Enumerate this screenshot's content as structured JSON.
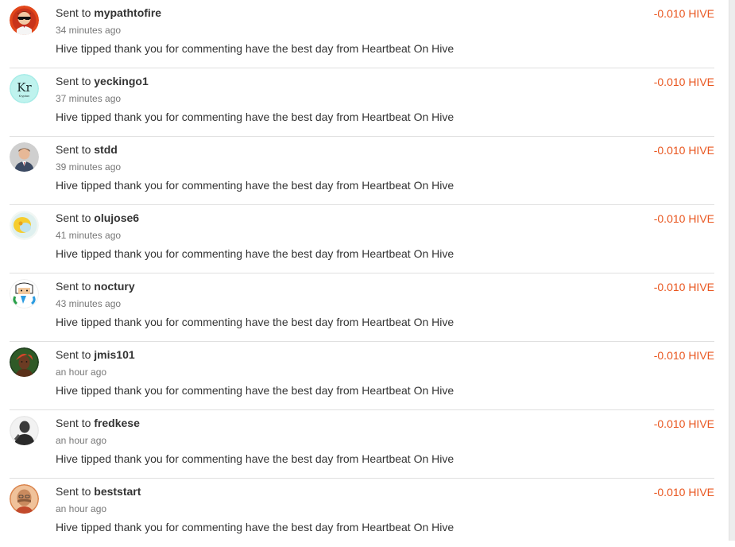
{
  "transfers": [
    {
      "prefix": "Sent to",
      "user": "mypathtofire",
      "time": "34 minutes ago",
      "memo": "Hive tipped thank you for commenting have the best day from Heartbeat On Hive",
      "amount": "-0.010 HIVE",
      "avatar": "avatar-sunglasses"
    },
    {
      "prefix": "Sent to",
      "user": "yeckingo1",
      "time": "37 minutes ago",
      "memo": "Hive tipped thank you for commenting have the best day from Heartbeat On Hive",
      "amount": "-0.010 HIVE",
      "avatar": "avatar-krypton"
    },
    {
      "prefix": "Sent to",
      "user": "stdd",
      "time": "39 minutes ago",
      "memo": "Hive tipped thank you for commenting have the best day from Heartbeat On Hive",
      "amount": "-0.010 HIVE",
      "avatar": "avatar-man-suit"
    },
    {
      "prefix": "Sent to",
      "user": "olujose6",
      "time": "41 minutes ago",
      "memo": "Hive tipped thank you for commenting have the best day from Heartbeat On Hive",
      "amount": "-0.010 HIVE",
      "avatar": "avatar-yellow-blob"
    },
    {
      "prefix": "Sent to",
      "user": "noctury",
      "time": "43 minutes ago",
      "memo": "Hive tipped thank you for commenting have the best day from Heartbeat On Hive",
      "amount": "-0.010 HIVE",
      "avatar": "avatar-cartoon"
    },
    {
      "prefix": "Sent to",
      "user": "jmis101",
      "time": "an hour ago",
      "memo": "Hive tipped thank you for commenting have the best day from Heartbeat On Hive",
      "amount": "-0.010 HIVE",
      "avatar": "avatar-woman"
    },
    {
      "prefix": "Sent to",
      "user": "fredkese",
      "time": "an hour ago",
      "memo": "Hive tipped thank you for commenting have the best day from Heartbeat On Hive",
      "amount": "-0.010 HIVE",
      "avatar": "avatar-bw-man"
    },
    {
      "prefix": "Sent to",
      "user": "beststart",
      "time": "an hour ago",
      "memo": "Hive tipped thank you for commenting have the best day from Heartbeat On Hive",
      "amount": "-0.010 HIVE",
      "avatar": "avatar-bald-man"
    }
  ],
  "colors": {
    "amount": "#e9561f",
    "divider": "#e0e0e0",
    "muted": "#777777",
    "text": "#333333"
  },
  "avatar_labels": {
    "krypton_symbol": "Kr",
    "krypton_name": "Krypton"
  }
}
